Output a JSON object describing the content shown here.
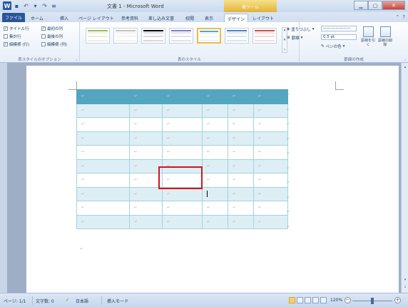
{
  "window": {
    "title": "文書 1 - Microsoft Word",
    "context_tab_group": "表ツール"
  },
  "tabs": [
    {
      "label": "ファイル"
    },
    {
      "label": "ホーム"
    },
    {
      "label": "挿入"
    },
    {
      "label": "ページ レイアウト"
    },
    {
      "label": "参考資料"
    },
    {
      "label": "差し込み文書"
    },
    {
      "label": "校閲"
    },
    {
      "label": "表示"
    },
    {
      "label": "デザイン"
    },
    {
      "label": "レイアウト"
    }
  ],
  "active_tab": "デザイン",
  "ribbon": {
    "style_options": {
      "group_label": "表スタイルのオプション",
      "options": [
        {
          "label": "タイトル行",
          "checked": true
        },
        {
          "label": "最初の列",
          "checked": true
        },
        {
          "label": "集計行",
          "checked": false
        },
        {
          "label": "最後の列",
          "checked": false
        },
        {
          "label": "縞模様 (行)",
          "checked": true
        },
        {
          "label": "縞模様 (列)",
          "checked": false
        }
      ]
    },
    "table_styles": {
      "group_label": "表のスタイル",
      "shading_label": "塗りつぶし",
      "borders_label": "罫線"
    },
    "draw_borders": {
      "group_label": "罫線の作成",
      "pen_weight": "0.5 pt",
      "pen_color_label": "ペンの色",
      "draw_table_label": "罫線を引く",
      "eraser_label": "罫線の削除"
    }
  },
  "statusbar": {
    "page": "ページ: 1/1",
    "word_count": "文字数: 0",
    "language": "日本語",
    "mode": "挿入モード",
    "zoom": "120%"
  },
  "colors": {
    "header_row": "#53a6bd",
    "band_row": "#ddeff4",
    "highlight": "#d0141c"
  },
  "table": {
    "rows": 10,
    "cols": 6,
    "cell_mark": "↵",
    "cursor_cell": {
      "row": 7,
      "col": 3
    }
  }
}
